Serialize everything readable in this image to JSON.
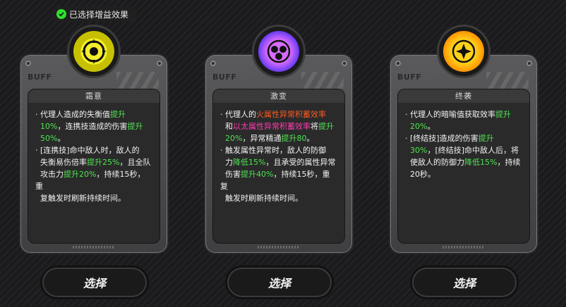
{
  "header": {
    "selected_badge": "已选择增益效果"
  },
  "colors": {
    "green": "#4fe34f",
    "orange": "#ff5a1f",
    "pink": "#ff3bb0"
  },
  "cards": [
    {
      "buff_label": "BUFF",
      "title": "霜意",
      "emblem_icon": "yellow-gear-emblem-icon",
      "emblem_color": "#e8e100",
      "lines": [
        {
          "a": "代理人造成的失衡值",
          "b": "提升",
          "c": ""
        },
        {
          "a": "",
          "b": "10%",
          "c": "，连携技造成的伤害"
        },
        {
          "a": "",
          "b": "提升",
          "c": ""
        },
        {
          "a": "",
          "b": "50%",
          "c": "。"
        },
        {
          "a": "[连携技]命中敌人时，敌人的",
          "b": "",
          "c": ""
        },
        {
          "a": "失衡易伤倍率",
          "b": "提升25%",
          "c": "，且全队"
        },
        {
          "a": "攻击力",
          "b": "提升20%",
          "c": "，持续15秒，重"
        },
        {
          "a": "复触发时刷新持续时间。",
          "b": "",
          "c": ""
        }
      ]
    },
    {
      "buff_label": "BUFF",
      "title": "激变",
      "emblem_icon": "purple-orb-emblem-icon",
      "emblem_color": "#c548ff",
      "lines": [
        {
          "a": "代理人的",
          "o": "火属性异常积蓄效率",
          "c": ""
        },
        {
          "a": "和",
          "p": "以太属性异常积蓄效率",
          "c": "将",
          "b": "提升"
        },
        {
          "b": "20%",
          "c": "，异常精通",
          "b2": "提升80",
          "c2": "。"
        },
        {
          "a": "触发属性异常时，敌人的防御",
          "c": ""
        },
        {
          "a": "力",
          "b": "降低15%",
          "c": "，且承受的属性异常"
        },
        {
          "a": "伤害",
          "b": "提升40%",
          "c": "，持续15秒，重复"
        },
        {
          "a": "触发时刷新持续时间。",
          "c": ""
        }
      ]
    },
    {
      "buff_label": "BUFF",
      "title": "终袭",
      "emblem_icon": "orange-star-emblem-icon",
      "emblem_color": "#ff9a00",
      "lines": [
        {
          "a": "代理人的暗喻值获取效率",
          "b": "提升",
          "c": ""
        },
        {
          "a": "",
          "b": "20%",
          "c": "。"
        },
        {
          "a": "[终结技]造成的伤害",
          "b": "提升",
          "c": ""
        },
        {
          "a": "",
          "b": "30%",
          "c": "，[终结技]命中敌人后，将"
        },
        {
          "a": "使敌人的防御力",
          "b": "降低15%",
          "c": "，持续"
        },
        {
          "a": "20秒。",
          "b": "",
          "c": ""
        }
      ]
    }
  ],
  "buttons": {
    "select_label": "选择"
  }
}
